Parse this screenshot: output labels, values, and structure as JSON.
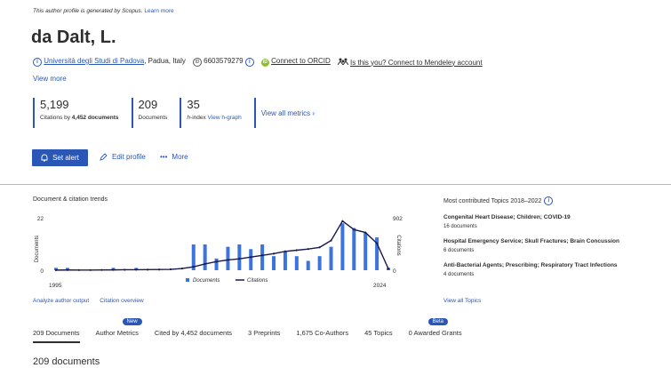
{
  "notice": {
    "text": "This author profile is generated by Scopus.",
    "link": "Learn more"
  },
  "author": {
    "name": "da Dalt, L."
  },
  "affiliation": {
    "university": "Università degli Studi di Padova",
    "location": ", Padua, Italy",
    "scopus_id": "6603579279",
    "orcid_link": "Connect to ORCID",
    "mendeley_link": "Is this you? Connect to Mendeley account",
    "view_more": "View more"
  },
  "metrics": [
    {
      "value": "5,199",
      "label_prefix": "Citations by ",
      "label_bold": "4,452 documents"
    },
    {
      "value": "209",
      "label": "Documents"
    },
    {
      "value": "35",
      "label_italic": "h",
      "label_rest": "-index ",
      "link": "View h-graph"
    },
    {
      "link": "View all metrics",
      "chevron": "›"
    }
  ],
  "actions": {
    "set_alert": "Set alert",
    "edit_profile": "Edit profile",
    "more": "More"
  },
  "trends": {
    "title": "Document & citation trends",
    "analyze_link": "Analyze author output",
    "overview_link": "Citation overview"
  },
  "chart_data": {
    "type": "bar",
    "title": "Document & citation trends",
    "left_axis": {
      "label": "Documents",
      "ticks": [
        "22",
        "0"
      ],
      "ylim": [
        0,
        22
      ]
    },
    "right_axis": {
      "label": "Citations",
      "ticks": [
        "902",
        "0"
      ],
      "ylim": [
        0,
        902
      ]
    },
    "x_range_labels": [
      "1995",
      "2024"
    ],
    "series": [
      {
        "name": "Documents",
        "kind": "bar",
        "color": "#3b73e0",
        "x": [
          1995,
          1996,
          1997,
          1998,
          1999,
          2000,
          2001,
          2002,
          2003,
          2004,
          2005,
          2006,
          2007,
          2008,
          2009,
          2010,
          2011,
          2012,
          2013,
          2014,
          2015,
          2016,
          2017,
          2018,
          2019,
          2020,
          2021,
          2022,
          2023,
          2024
        ],
        "values": [
          1,
          1,
          0,
          0,
          0,
          1,
          0,
          1,
          0,
          0,
          0,
          0,
          11,
          11,
          5,
          10,
          11,
          9,
          11,
          6,
          8,
          6,
          4,
          6,
          10,
          20,
          18,
          16,
          14,
          1
        ]
      },
      {
        "name": "Citations",
        "kind": "line",
        "color": "#1a1a4e",
        "x": [
          1995,
          1996,
          1997,
          1998,
          1999,
          2000,
          2001,
          2002,
          2003,
          2004,
          2005,
          2006,
          2007,
          2008,
          2009,
          2010,
          2011,
          2012,
          2013,
          2014,
          2015,
          2016,
          2017,
          2018,
          2019,
          2020,
          2021,
          2022,
          2023,
          2024
        ],
        "values": [
          2,
          4,
          3,
          3,
          5,
          6,
          8,
          9,
          10,
          12,
          15,
          30,
          60,
          110,
          150,
          180,
          200,
          230,
          260,
          290,
          330,
          350,
          370,
          400,
          520,
          860,
          710,
          660,
          470,
          25
        ]
      }
    ]
  },
  "legend": {
    "documents": "Documents",
    "citations": "Citations"
  },
  "topics": {
    "title": "Most contributed Topics 2018–2022",
    "items": [
      {
        "name": "Congenital Heart Disease; Children; COVID-19",
        "count": "16 documents"
      },
      {
        "name": "Hospital Emergency Service; Skull Fractures; Brain Concussion",
        "count": "6 documents"
      },
      {
        "name": "Anti-Bacterial Agents; Prescribing; Respiratory Tract Infections",
        "count": "4 documents"
      }
    ],
    "view_all": "View all Topics"
  },
  "tabs": [
    {
      "label": "209 Documents",
      "active": true
    },
    {
      "label": "Author Metrics",
      "badge": "New"
    },
    {
      "label": "Cited by 4,452 documents"
    },
    {
      "label": "3 Preprints"
    },
    {
      "label": "1,675 Co-Authors"
    },
    {
      "label": "45 Topics"
    },
    {
      "label": "0 Awarded Grants",
      "badge": "Beta"
    }
  ],
  "documents_heading": "209 documents",
  "colors": {
    "accent": "#2a57b6",
    "bar": "#3b73e0",
    "line": "#1a1a4e"
  }
}
